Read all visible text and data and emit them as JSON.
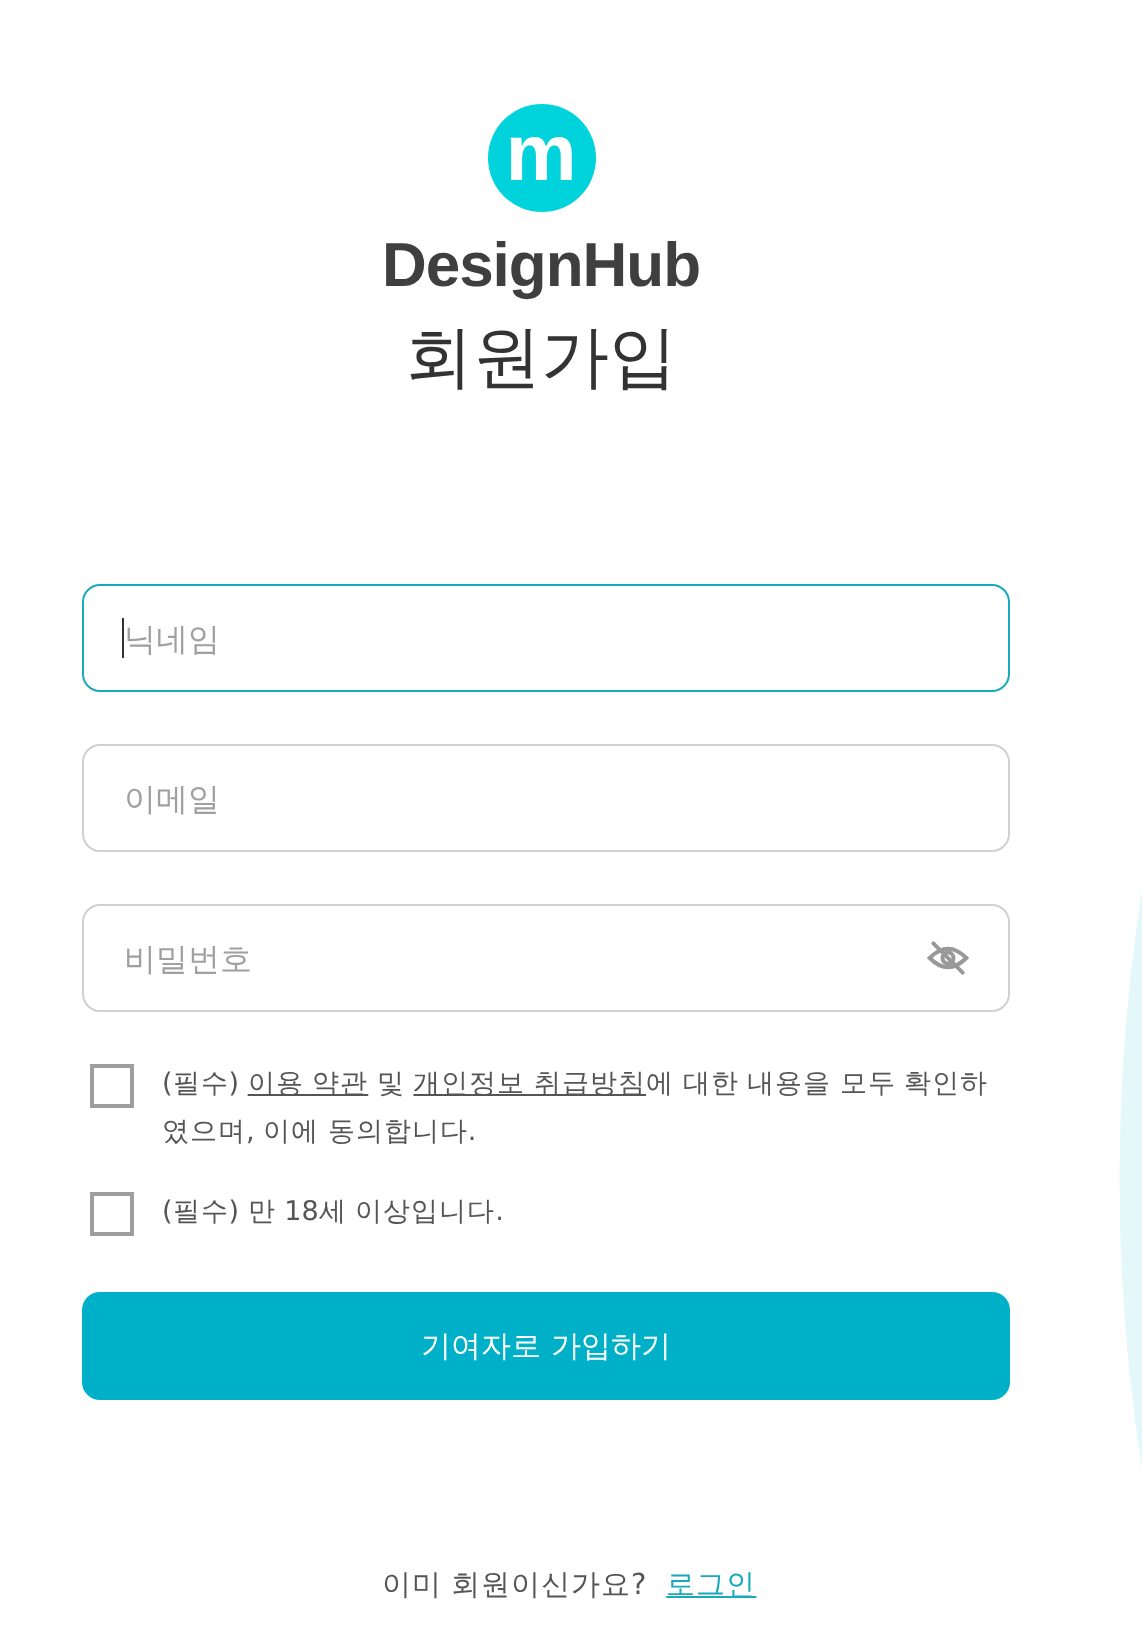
{
  "logo": {
    "letter": "m",
    "name": "DesignHub"
  },
  "title": "회원가입",
  "fields": [
    {
      "placeholder": "닉네임",
      "focused": true,
      "kind": "text"
    },
    {
      "placeholder": "이메일",
      "focused": false,
      "kind": "text"
    },
    {
      "placeholder": "비밀번호",
      "focused": false,
      "kind": "password"
    }
  ],
  "agreements": [
    {
      "checked": false,
      "parts": [
        {
          "text": "(필수) ",
          "link": false
        },
        {
          "text": "이용 약관",
          "link": true
        },
        {
          "text": " 및 ",
          "link": false
        },
        {
          "text": "개인정보 취급방침",
          "link": true
        },
        {
          "text": "에 대한 내용을 모두 확인하였으며, 이에 동의합니다.",
          "link": false
        }
      ]
    },
    {
      "checked": false,
      "parts": [
        {
          "text": "(필수) 만 18세 이상입니다.",
          "link": false
        }
      ]
    }
  ],
  "submit": "기여자로 가입하기",
  "footer": {
    "text": "이미 회원이신가요?",
    "link": "로그인"
  }
}
